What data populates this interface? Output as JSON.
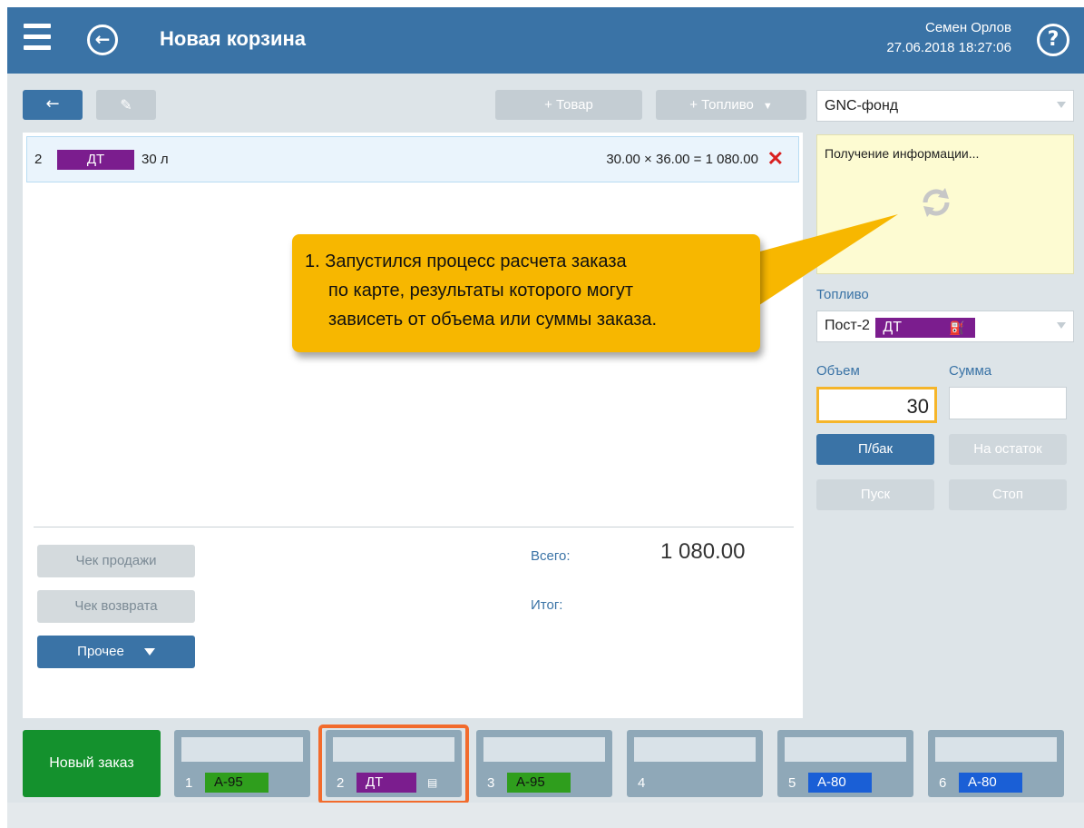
{
  "header": {
    "title": "Новая корзина",
    "user_name": "Семен Орлов",
    "datetime": "27.06.2018 18:27:06",
    "help_symbol": "?",
    "back_symbol": "←"
  },
  "toolbar": {
    "back_label": "←",
    "edit_icon": "✎",
    "add_goods_label": "+ Товар",
    "add_fuel_label": "+ Топливо",
    "fuel_caret": "▼"
  },
  "right_panel": {
    "discount_select": "GNC-фонд",
    "info_text": "Получение информации...",
    "fuel_label": "Топливо",
    "fuel_post": "Пост-2",
    "fuel_type": "ДТ",
    "volume_label": "Объем",
    "sum_label": "Сумма",
    "volume_value": "30",
    "sum_value": "",
    "btn_full_tank": "П/бак",
    "btn_remainder": "На остаток",
    "btn_start": "Пуск",
    "btn_stop": "Стоп"
  },
  "order": {
    "items": [
      {
        "num": "2",
        "fuel": "ДТ",
        "qty": "30 л",
        "calc": "30.00 × 36.00 = 1 080.00",
        "delete_symbol": "✕"
      }
    ],
    "total_label": "Всего:",
    "total_value": "1 080.00",
    "final_label": "Итог:",
    "btn_sale_receipt": "Чек продажи",
    "btn_refund_receipt": "Чек возврата",
    "btn_other": "Прочее"
  },
  "callout": {
    "line1": "1. Запустился процесс расчета заказа",
    "line2": "по карте, результаты которого могут",
    "line3": "зависеть от объема или суммы заказа."
  },
  "bottom_tabs": {
    "new_order_label": "Новый заказ",
    "tabs": [
      {
        "num": "1",
        "fuel": "A-95",
        "color": "#2f9e1d"
      },
      {
        "num": "2",
        "fuel": "ДТ",
        "color": "#7b1d8e"
      },
      {
        "num": "3",
        "fuel": "A-95",
        "color": "#2f9e1d"
      },
      {
        "num": "4",
        "fuel": "",
        "color": ""
      },
      {
        "num": "5",
        "fuel": "A-80",
        "color": "#1a5fd6"
      },
      {
        "num": "6",
        "fuel": "A-80",
        "color": "#1a5fd6"
      }
    ]
  },
  "colors": {
    "header_bg": "#3a73a6",
    "accent_orange": "#f26b2c",
    "callout_yellow": "#f7b700",
    "diesel_purple": "#7b1d8e",
    "a95_green": "#2f9e1d",
    "a80_blue": "#1a5fd6",
    "new_order_green": "#14912d"
  }
}
